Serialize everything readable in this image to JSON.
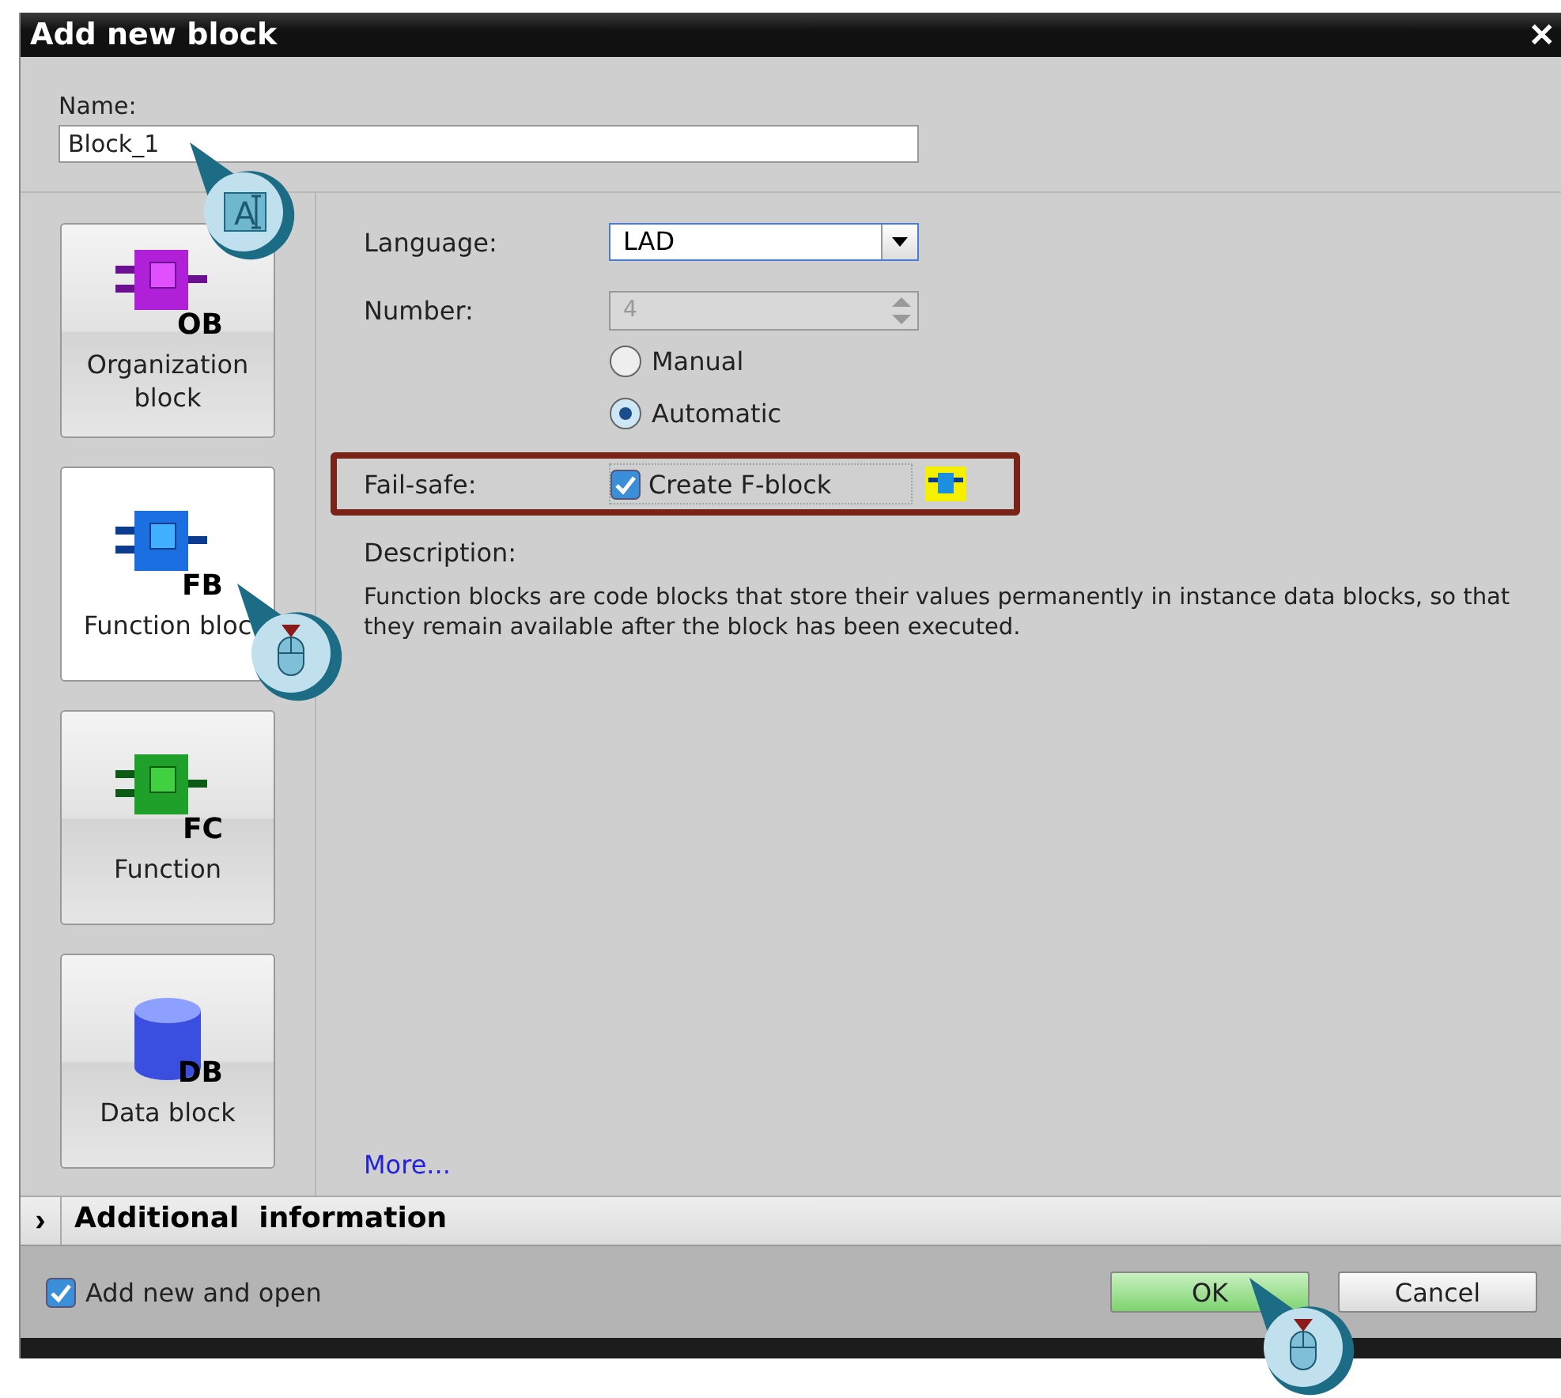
{
  "window": {
    "title": "Add new block",
    "close": "✕"
  },
  "name": {
    "label": "Name:",
    "value": "Block_1"
  },
  "block_types": [
    {
      "kind": "ob",
      "badge": "OB",
      "label": "Organization block",
      "selected": false
    },
    {
      "kind": "fb",
      "badge": "FB",
      "label": "Function bloc",
      "selected": true
    },
    {
      "kind": "fc",
      "badge": "FC",
      "label": "Function",
      "selected": false
    },
    {
      "kind": "db",
      "badge": "DB",
      "label": "Data block",
      "selected": false
    }
  ],
  "language": {
    "label": "Language:",
    "value": "LAD"
  },
  "number": {
    "label": "Number:",
    "value": "4",
    "disabled": true
  },
  "numbering": [
    {
      "label": "Manual",
      "selected": false
    },
    {
      "label": "Automatic",
      "selected": true
    }
  ],
  "fail_safe": {
    "label": "Fail-safe:",
    "option": "Create F-block",
    "checked": true,
    "highlighted": true
  },
  "description": {
    "label": "Description:",
    "text": "Function blocks are code blocks that store their values permanently in instance data blocks, so that they remain available after the block has been executed."
  },
  "more_link": "More...",
  "additional_information": {
    "label": "Additional  information",
    "expanded": false,
    "toggle": "›"
  },
  "add_new_and_open": {
    "label": "Add new and open",
    "checked": true
  },
  "buttons": [
    {
      "label": "OK",
      "kind": "primary"
    },
    {
      "label": "Cancel",
      "kind": "secondary"
    }
  ],
  "callouts": [
    {
      "kind": "text",
      "glyph": "A"
    },
    {
      "kind": "mouse"
    },
    {
      "kind": "mouse"
    }
  ]
}
